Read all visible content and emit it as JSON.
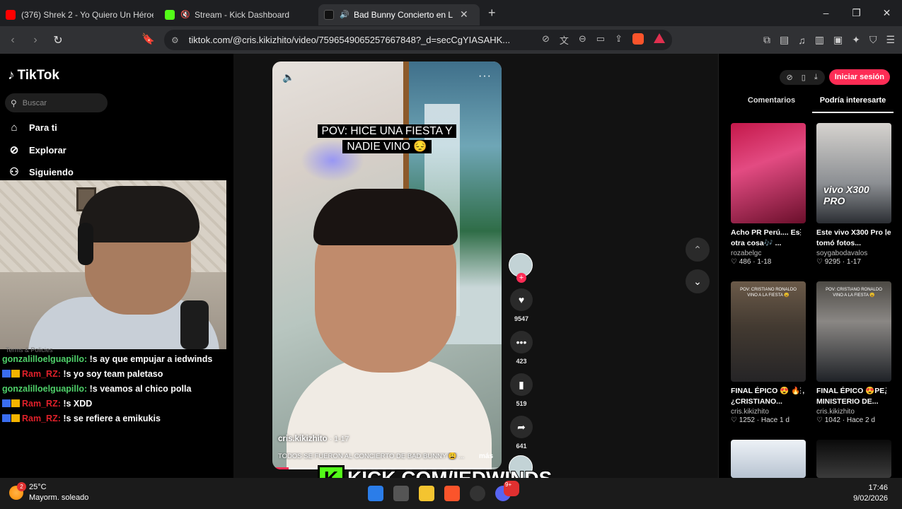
{
  "browser": {
    "tabs": [
      {
        "title": "(376) Shrek 2 - Yo Quiero Un Héroe (",
        "favicon_color": "#ff0000",
        "active": false
      },
      {
        "title": "Stream - Kick Dashboard",
        "favicon_color": "#53fc18",
        "active": false
      },
      {
        "title": "Bad Bunny Concierto en Lima",
        "favicon_color": "#111111",
        "active": true
      }
    ],
    "new_tab": "+",
    "url": "tiktok.com/@cris.kikizhito/video/7596549065257667848?_d=secCgYIASAHK...",
    "window_controls": [
      "–",
      "❐",
      "✕"
    ]
  },
  "tiktok": {
    "brand": "TikTok",
    "search_placeholder": "Buscar",
    "nav": [
      {
        "label": "Para ti",
        "icon": "home-icon"
      },
      {
        "label": "Explorar",
        "icon": "compass-icon"
      },
      {
        "label": "Siguiendo",
        "icon": "user-follow-icon"
      }
    ],
    "video": {
      "caption": "POV: HICE UNA FIESTA Y NADIE VINO 😔",
      "author": "cris.kikizhito",
      "date": "· 1-17",
      "description": "TODOS SE FUERON AL CONCIERTO DE BAD BUNNY 😩 ...",
      "more": "más",
      "progress": 0.07
    },
    "actions": {
      "likes": "9547",
      "comments": "423",
      "saves": "519",
      "shares": "641"
    },
    "panel": {
      "login": "Iniciar sesión",
      "tabs": [
        "Comentarios",
        "Podría interesarte"
      ],
      "cards": [
        {
          "title": "Acho PR Perú.... Es otra cosa🎶 ...",
          "author": "rozabelgc",
          "meta": "♡ 486 · 1-18",
          "overlay": ""
        },
        {
          "title": "Este vivo X300 Pro le tomó fotos...",
          "author": "soygabodavalos",
          "meta": "♡ 9295 · 1-17",
          "overlay": "vivo X300 PRO"
        },
        {
          "title": "FINAL ÉPICO 😍 🔥 , ¿CRISTIANO...",
          "author": "cris.kikizhito",
          "meta": "♡ 1252 · Hace 1 d",
          "overlay": "POV: CRISTIANO RONALDO VINO A LA FIESTA 😩"
        },
        {
          "title": "FINAL ÉPICO 😍PE, MINISTERIO DE...",
          "author": "cris.kikizhito",
          "meta": "♡ 1042 · Hace 2 d",
          "overlay": "POV: CRISTIANO RONALDO VINO A LA FIESTA 😩"
        }
      ]
    }
  },
  "chat": {
    "terms": "Terms & Policies",
    "messages": [
      {
        "user": "gonzalilloelguapillo:",
        "text": " !s ay que empujar a iedwinds",
        "badges": false,
        "color": "green"
      },
      {
        "user": "Ram_RZ:",
        "text": " !s yo soy team paletaso",
        "badges": true,
        "color": "red"
      },
      {
        "user": "gonzalilloelguapillo:",
        "text": " !s veamos al chico polla",
        "badges": false,
        "color": "green"
      },
      {
        "user": "Ram_RZ:",
        "text": " !s XDD",
        "badges": true,
        "color": "red"
      },
      {
        "user": "Ram_RZ:",
        "text": " !s se refiere a emikukis",
        "badges": true,
        "color": "red"
      }
    ]
  },
  "kick_overlay": {
    "logo_letter": "K",
    "text": "KICK.COM/IEDWINDS",
    "color": "#53fc18"
  },
  "taskbar": {
    "weather_temp": "25°C",
    "weather_desc": "Mayorm. soleado",
    "weather_badge": "2",
    "discord_badge": "9+",
    "time": "17:46",
    "date": "9/02/2026"
  }
}
